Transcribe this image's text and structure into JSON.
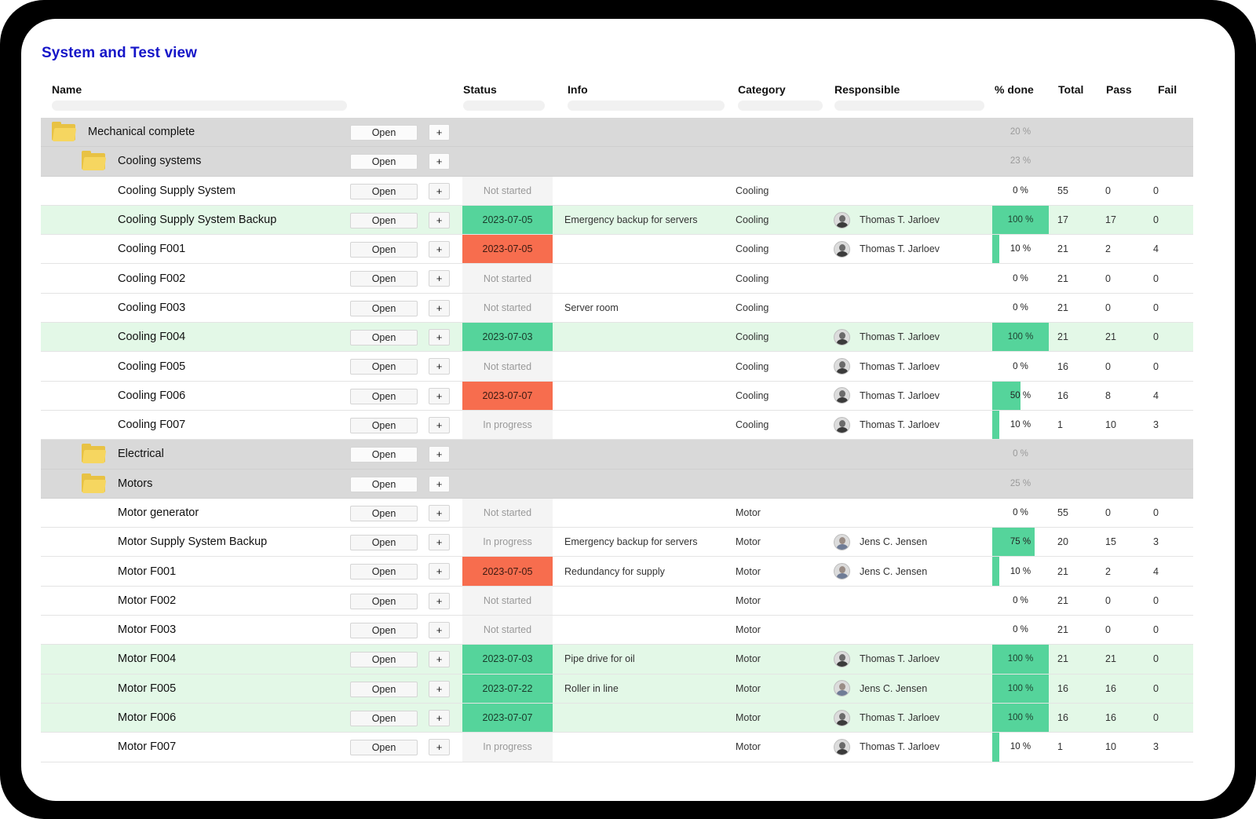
{
  "title": "System and Test view",
  "columns": {
    "name": "Name",
    "status": "Status",
    "info": "Info",
    "category": "Category",
    "responsible": "Responsible",
    "pct_done": "% done",
    "total": "Total",
    "pass": "Pass",
    "fail": "Fail"
  },
  "buttons": {
    "open": "Open",
    "add": "+"
  },
  "colors": {
    "title": "#1515c8",
    "status_green": "#55d49b",
    "status_red": "#f76d4e",
    "row_done": "#e3f8e7",
    "group_row": "#d9d9d9",
    "folder": "#f6d660"
  },
  "rows": [
    {
      "type": "group",
      "level": 0,
      "name": "Mechanical complete",
      "pct": 20,
      "pct_label": "20 %",
      "icon": "folder-icon"
    },
    {
      "type": "group",
      "level": 1,
      "name": "Cooling systems",
      "pct": 23,
      "pct_label": "23 %",
      "icon": "folder-icon"
    },
    {
      "type": "item",
      "name": "Cooling Supply System",
      "status": "Not started",
      "status_color": "none",
      "info": "",
      "category": "Cooling",
      "responsible": "",
      "pct": 0,
      "pct_label": "0 %",
      "total": "55",
      "pass": "0",
      "fail": "0",
      "done": false
    },
    {
      "type": "item",
      "name": "Cooling Supply System Backup",
      "status": "2023-07-05",
      "status_color": "green",
      "info": "Emergency backup for servers",
      "category": "Cooling",
      "responsible": "Thomas T. Jarloev",
      "pct": 100,
      "pct_label": "100 %",
      "total": "17",
      "pass": "17",
      "fail": "0",
      "done": true
    },
    {
      "type": "item",
      "name": "Cooling F001",
      "status": "2023-07-05",
      "status_color": "red",
      "info": "",
      "category": "Cooling",
      "responsible": "Thomas T. Jarloev",
      "pct": 10,
      "pct_label": "10 %",
      "total": "21",
      "pass": "2",
      "fail": "4",
      "done": false
    },
    {
      "type": "item",
      "name": "Cooling F002",
      "status": "Not started",
      "status_color": "none",
      "info": "",
      "category": "Cooling",
      "responsible": "",
      "pct": 0,
      "pct_label": "0 %",
      "total": "21",
      "pass": "0",
      "fail": "0",
      "done": false
    },
    {
      "type": "item",
      "name": "Cooling F003",
      "status": "Not started",
      "status_color": "none",
      "info": "Server room",
      "category": "Cooling",
      "responsible": "",
      "pct": 0,
      "pct_label": "0 %",
      "total": "21",
      "pass": "0",
      "fail": "0",
      "done": false
    },
    {
      "type": "item",
      "name": "Cooling F004",
      "status": "2023-07-03",
      "status_color": "green",
      "info": "",
      "category": "Cooling",
      "responsible": "Thomas T. Jarloev",
      "pct": 100,
      "pct_label": "100 %",
      "total": "21",
      "pass": "21",
      "fail": "0",
      "done": true
    },
    {
      "type": "item",
      "name": "Cooling F005",
      "status": "Not started",
      "status_color": "none",
      "info": "",
      "category": "Cooling",
      "responsible": "Thomas T. Jarloev",
      "pct": 0,
      "pct_label": "0 %",
      "total": "16",
      "pass": "0",
      "fail": "0",
      "done": false
    },
    {
      "type": "item",
      "name": "Cooling F006",
      "status": "2023-07-07",
      "status_color": "red",
      "info": "",
      "category": "Cooling",
      "responsible": "Thomas T. Jarloev",
      "pct": 50,
      "pct_label": "50 %",
      "total": "16",
      "pass": "8",
      "fail": "4",
      "done": false
    },
    {
      "type": "item",
      "name": "Cooling F007",
      "status": "In progress",
      "status_color": "none",
      "info": "",
      "category": "Cooling",
      "responsible": "Thomas T. Jarloev",
      "pct": 10,
      "pct_label": "10 %",
      "total": "1",
      "pass": "10",
      "fail": "3",
      "done": false
    },
    {
      "type": "group",
      "level": 1,
      "name": "Electrical",
      "pct": 0,
      "pct_label": "0 %",
      "icon": "folder-icon"
    },
    {
      "type": "group",
      "level": 1,
      "name": "Motors",
      "pct": 25,
      "pct_label": "25 %",
      "icon": "folder-icon"
    },
    {
      "type": "item",
      "name": "Motor generator",
      "status": "Not started",
      "status_color": "none",
      "info": "",
      "category": "Motor",
      "responsible": "",
      "pct": 0,
      "pct_label": "0 %",
      "total": "55",
      "pass": "0",
      "fail": "0",
      "done": false
    },
    {
      "type": "item",
      "name": "Motor Supply System Backup",
      "status": "In progress",
      "status_color": "none",
      "info": "Emergency backup for servers",
      "category": "Motor",
      "responsible": "Jens C. Jensen",
      "pct": 75,
      "pct_label": "75 %",
      "total": "20",
      "pass": "15",
      "fail": "3",
      "done": false
    },
    {
      "type": "item",
      "name": "Motor F001",
      "status": "2023-07-05",
      "status_color": "red",
      "info": "Redundancy for supply",
      "category": "Motor",
      "responsible": "Jens C. Jensen",
      "pct": 10,
      "pct_label": "10 %",
      "total": "21",
      "pass": "2",
      "fail": "4",
      "done": false
    },
    {
      "type": "item",
      "name": "Motor F002",
      "status": "Not started",
      "status_color": "none",
      "info": "",
      "category": "Motor",
      "responsible": "",
      "pct": 0,
      "pct_label": "0 %",
      "total": "21",
      "pass": "0",
      "fail": "0",
      "done": false
    },
    {
      "type": "item",
      "name": "Motor F003",
      "status": "Not started",
      "status_color": "none",
      "info": "",
      "category": "Motor",
      "responsible": "",
      "pct": 0,
      "pct_label": "0 %",
      "total": "21",
      "pass": "0",
      "fail": "0",
      "done": false
    },
    {
      "type": "item",
      "name": "Motor F004",
      "status": "2023-07-03",
      "status_color": "green",
      "info": "Pipe drive for oil",
      "category": "Motor",
      "responsible": "Thomas T. Jarloev",
      "pct": 100,
      "pct_label": "100 %",
      "total": "21",
      "pass": "21",
      "fail": "0",
      "done": true
    },
    {
      "type": "item",
      "name": "Motor F005",
      "status": "2023-07-22",
      "status_color": "green",
      "info": "Roller in line",
      "category": "Motor",
      "responsible": "Jens C. Jensen",
      "pct": 100,
      "pct_label": "100 %",
      "total": "16",
      "pass": "16",
      "fail": "0",
      "done": true
    },
    {
      "type": "item",
      "name": "Motor F006",
      "status": "2023-07-07",
      "status_color": "green",
      "info": "",
      "category": "Motor",
      "responsible": "Thomas T. Jarloev",
      "pct": 100,
      "pct_label": "100 %",
      "total": "16",
      "pass": "16",
      "fail": "0",
      "done": true
    },
    {
      "type": "item",
      "name": "Motor F007",
      "status": "In progress",
      "status_color": "none",
      "info": "",
      "category": "Motor",
      "responsible": "Thomas T. Jarloev",
      "pct": 10,
      "pct_label": "10 %",
      "total": "1",
      "pass": "10",
      "fail": "3",
      "done": false
    }
  ]
}
